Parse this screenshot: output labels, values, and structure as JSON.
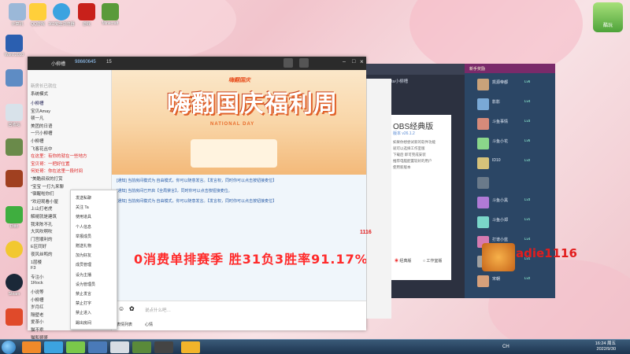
{
  "desktop": {
    "icons": [
      "计算机",
      "QQ游戏",
      "360安全浏览器",
      "游戏",
      "Minecraft",
      "Word 2010",
      "",
      "",
      "",
      "",
      "回收站",
      "",
      "",
      "Ditto",
      "",
      "",
      "",
      "Steam",
      "",
      ""
    ],
    "top_right_icon": "酷玩"
  },
  "taskbar": {
    "lang": "CH",
    "time": "16:24 周五",
    "date": "2022/9/30"
  },
  "qq": {
    "title": "小柳槽",
    "room_id": "98660645",
    "online": "15",
    "left_header": "新房长已就位",
    "left_sub": "系统模式",
    "rooms": [
      {
        "text": "小柳槽",
        "style": "blue"
      },
      {
        "text": "宝贝Amay",
        "style": ""
      },
      {
        "text": "顿一凡",
        "style": ""
      },
      {
        "text": "美团的日语",
        "style": ""
      },
      {
        "text": "一只小柳槽",
        "style": ""
      },
      {
        "text": "小柳槽",
        "style": ""
      },
      {
        "text": "飞客花丛中",
        "style": ""
      },
      {
        "text": "在这里：有你的就在一些地方",
        "style": "red"
      },
      {
        "text": "宝贝哥：一把好位置",
        "style": "red"
      },
      {
        "text": "何处哥：你在这里一段时间",
        "style": "red"
      },
      {
        "text": "\"美酷叔叔的打赏",
        "style": ""
      },
      {
        "text": "\"宝宝 一打九来聊",
        "style": ""
      },
      {
        "text": "\"宿醒啦你们",
        "style": ""
      },
      {
        "text": "\"欢迎观看小屋",
        "style": ""
      },
      {
        "text": "上山打老虎",
        "style": ""
      },
      {
        "text": "解褪就是建筑",
        "style": ""
      },
      {
        "text": "我来陈不孔",
        "style": ""
      },
      {
        "text": "大风吹啊吹",
        "style": ""
      },
      {
        "text": "门宫顺利的",
        "style": ""
      },
      {
        "text": "E区同好",
        "style": ""
      },
      {
        "text": "夜风丝鸭的",
        "style": ""
      },
      {
        "text": "1层楼",
        "style": ""
      },
      {
        "text": "F3",
        "style": ""
      },
      {
        "text": "专注小",
        "style": ""
      },
      {
        "text": "1Rock",
        "style": ""
      },
      {
        "text": "小说等",
        "style": ""
      },
      {
        "text": "小柳槽",
        "style": ""
      },
      {
        "text": "岁月红",
        "style": ""
      },
      {
        "text": "隔壁老",
        "style": ""
      },
      {
        "text": "爱茶小",
        "style": ""
      },
      {
        "text": "猫不乖",
        "style": ""
      },
      {
        "text": "猫和哥哥",
        "style": ""
      }
    ],
    "banner": {
      "tag": "嗨翻国庆",
      "title": "嗨翻国庆福利周",
      "sub": "NATIONAL DAY"
    },
    "notices": [
      "[通知] 当前房间模式为 自由模式，你可以随意发言。【发言权，同时你可以点击按钮接麦位】",
      "[通知] 当前房间已开启【全局禁言】，同时你可以点击按钮接麦位。",
      "[通知] 当前房间模式为 自由模式，你可以随意发言。【发言权，同时你可以点击按钮接麦位】"
    ],
    "input_placeholder": "说点什么吧…",
    "send_label": "表情列表",
    "mood_label": "心情"
  },
  "context_menu": {
    "items": [
      "发送私聊",
      "关注 Ta",
      "使用道具",
      "个人信息",
      "举报成员",
      "赠送礼物",
      "加为好友",
      "成员管理",
      "设为主播",
      "设为管理员",
      "禁止发言",
      "禁止打字",
      "禁止进入",
      "踢出房间"
    ]
  },
  "overlay": {
    "text": "0消费单排赛季 胜31负3胜率91.17%",
    "adie": "adie1116",
    "side_number": "1116"
  },
  "obs": {
    "title": "Dota小柳槽",
    "heading": "OBS经典版",
    "version": "版本 v26.1.2",
    "radios": [
      "经典版",
      "工作室版"
    ],
    "body_lines": [
      "如果你想尝试新的软件功能",
      "就可以选择工作室版",
      "下载后 即可完成安装",
      "推荐电脑配置较好的用户",
      "使用新版本"
    ]
  },
  "game": {
    "title": "新手奖励",
    "seats": [
      {
        "name": "凯源帝都",
        "lv": "Lv6"
      },
      {
        "name": "影影",
        "lv": "Lv4"
      },
      {
        "name": "斗鱼事情",
        "lv": "Lv3"
      },
      {
        "name": "斗鱼小花",
        "lv": "Lv5"
      },
      {
        "name": "ID10",
        "lv": "Lv2"
      },
      {
        "name": "",
        "lv": ""
      },
      {
        "name": "斗鱼小黑",
        "lv": "Lv3"
      },
      {
        "name": "斗鱼小郑",
        "lv": "Lv1"
      },
      {
        "name": "打谱小蓝",
        "lv": "Lv4"
      },
      {
        "name": "斗鱼小马",
        "lv": "Lv1"
      },
      {
        "name": "宋朝",
        "lv": "Lv2"
      }
    ]
  }
}
